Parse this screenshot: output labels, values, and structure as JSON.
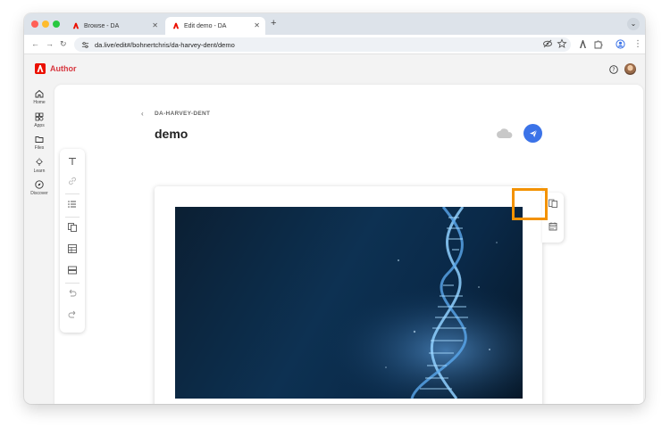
{
  "browser": {
    "tabs": [
      {
        "label": "Browse - DA",
        "active": false
      },
      {
        "label": "Edit demo - DA",
        "active": true
      }
    ],
    "url": "da.live/edit#/bohnertchris/da-harvey-dent/demo"
  },
  "app": {
    "name": "Author",
    "brand_color": "#eb1000"
  },
  "sidenav": {
    "items": [
      {
        "label": "Home",
        "icon": "home-icon"
      },
      {
        "label": "Apps",
        "icon": "apps-icon"
      },
      {
        "label": "Files",
        "icon": "folder-icon"
      },
      {
        "label": "Learn",
        "icon": "lightbulb-icon"
      },
      {
        "label": "Discover",
        "icon": "compass-icon"
      }
    ]
  },
  "editor": {
    "breadcrumb": "DA-HARVEY-DENT",
    "title": "demo",
    "toolbar_icons": [
      "text-icon",
      "link-icon",
      "list-icon",
      "blocks-icon",
      "table-icon",
      "section-icon",
      "undo-icon",
      "redo-icon"
    ],
    "side_tools": [
      "library-icon",
      "calendar-icon"
    ],
    "highlight_color": "#f39200",
    "publish_color": "#3b73e8"
  }
}
